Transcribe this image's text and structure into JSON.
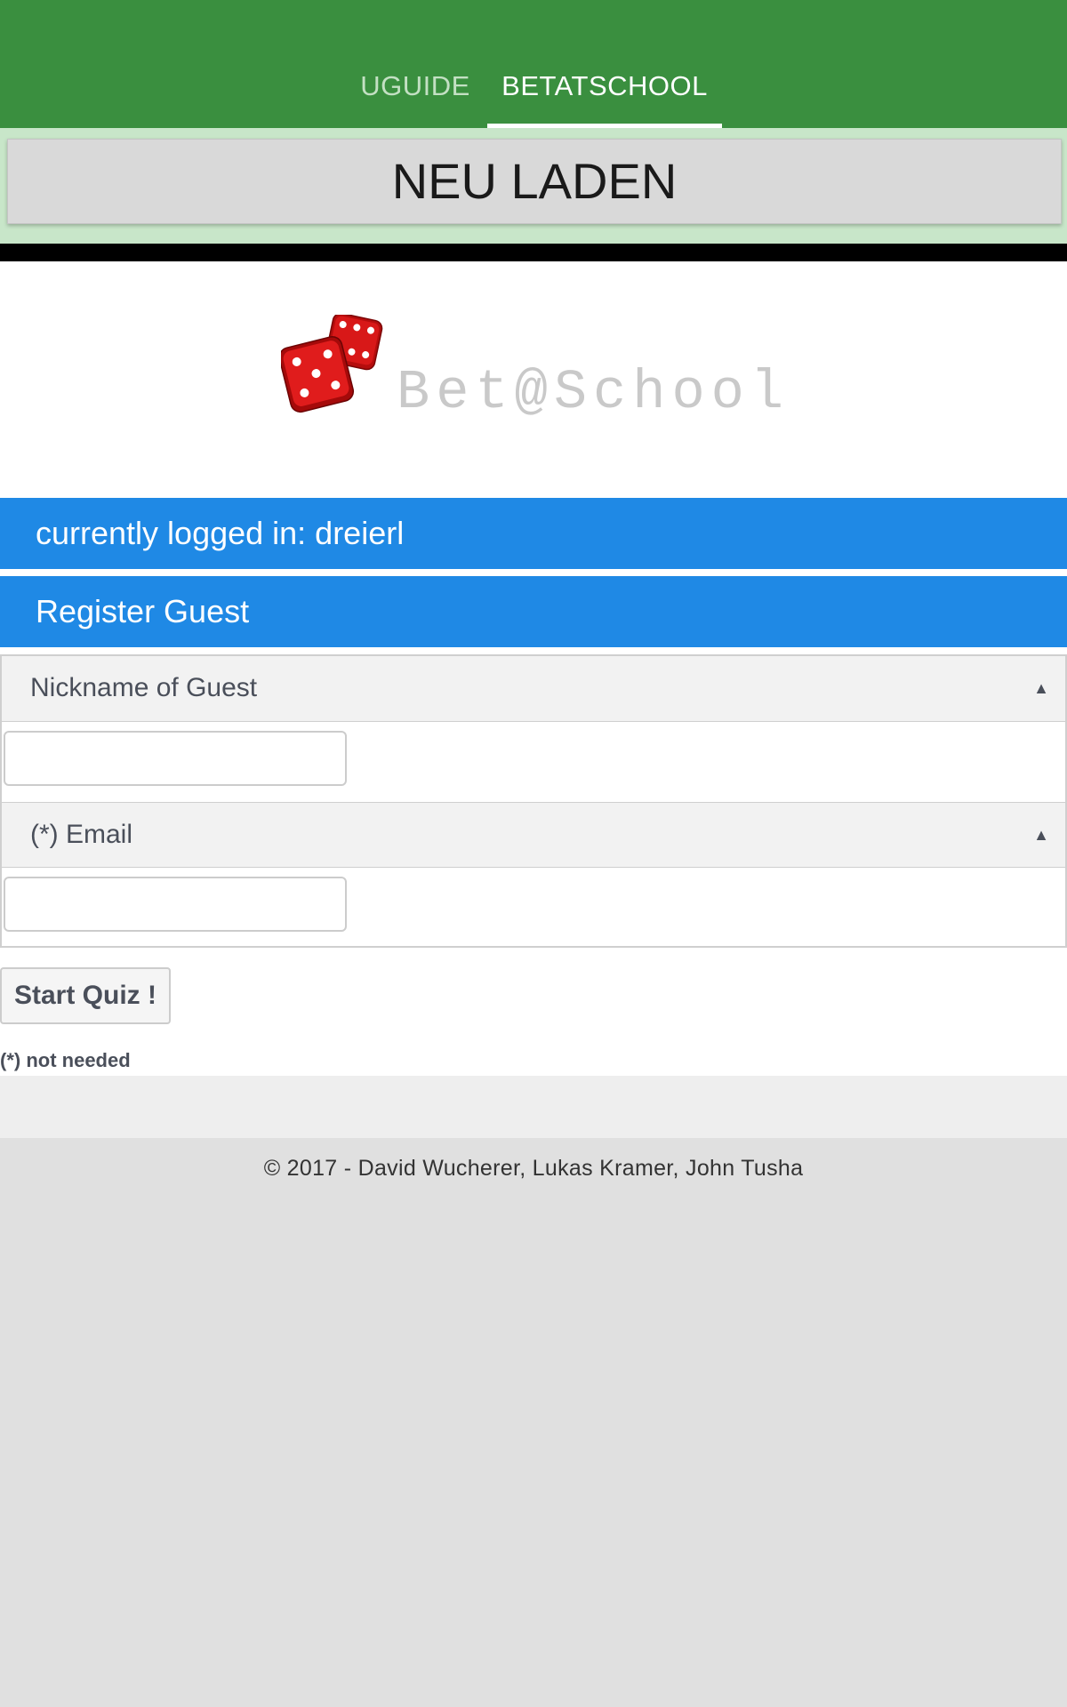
{
  "tabs": [
    {
      "label": "UGUIDE",
      "active": false
    },
    {
      "label": "BETATSCHOOL",
      "active": true
    }
  ],
  "reload_button": {
    "label": "NEU LADEN"
  },
  "logo": {
    "text": "Bet@School",
    "icon": "dice-icon"
  },
  "session": {
    "status_text": "currently logged in: dreierl"
  },
  "register": {
    "header": "Register Guest",
    "fields": [
      {
        "label": "Nickname of Guest",
        "value": "",
        "placeholder": "",
        "icon": "triangle-up-icon"
      },
      {
        "label": "(*) Email",
        "value": "",
        "placeholder": "",
        "icon": "triangle-up-icon"
      }
    ],
    "submit_label": "Start Quiz !",
    "footnote": "(*) not needed"
  },
  "footer": {
    "text": "© 2017 - David Wucherer, Lukas Kramer, John Tusha"
  },
  "colors": {
    "topbar": "#3a8f3f",
    "reload_background": "#c8e6c9",
    "info_bar": "#1f89e5",
    "logo_text": "#c9c9c9",
    "dice": "#d41414"
  }
}
